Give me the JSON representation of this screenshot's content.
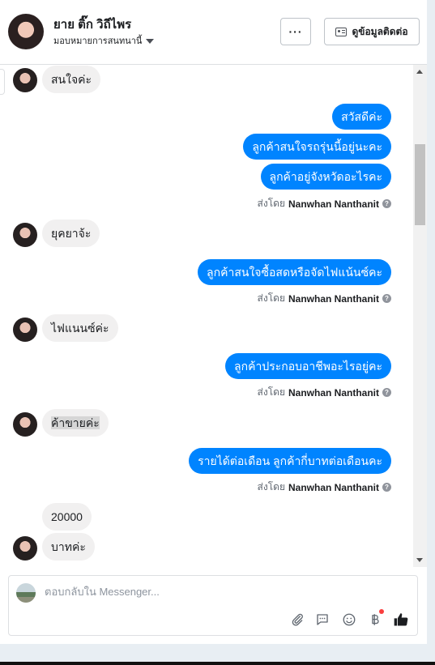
{
  "header": {
    "name": "ยาย ติ๊ก วิถีไพร",
    "assign_label": "มอบหมายการสนทนานี้",
    "more_label": "···",
    "contact_button": "ดูข้อมูลติดต่อ"
  },
  "messages": [
    {
      "dir": "in",
      "text": "สนใจค่ะ"
    },
    {
      "dir": "out",
      "text": "สวัสดีค่ะ"
    },
    {
      "dir": "out",
      "text": "ลูกค้าสนใจรถรุ่นนี้อยู่นะคะ"
    },
    {
      "dir": "out",
      "text": "ลูกค้าอยู่จังหวัดอะไรคะ"
    },
    {
      "dir": "in",
      "text": "ยุคยาจ้ะ"
    },
    {
      "dir": "out",
      "text": "ลูกค้าสนใจซื้อสดหรือจัดไฟแน้นซ์คะ"
    },
    {
      "dir": "in",
      "text": "ไฟแนนซ์ค่ะ"
    },
    {
      "dir": "out",
      "text": "ลูกค้าประกอบอาชีพอะไรอยู่คะ"
    },
    {
      "dir": "in",
      "text": "ค้าขายค่ะ"
    },
    {
      "dir": "out",
      "text": "รายได้ต่อเดือน ลูกค้ากี่บาทต่อเดือนคะ"
    },
    {
      "dir": "in",
      "text": "20000"
    },
    {
      "dir": "in",
      "text": "บาทค่ะ"
    }
  ],
  "sent_by": {
    "prefix": "ส่งโดย",
    "name": "Nanwhan Nanthanit",
    "info_icon": "?"
  },
  "composer": {
    "placeholder": "ตอบกลับใน Messenger..."
  },
  "icons": [
    "attachment-icon",
    "saved-reply-icon",
    "emoji-icon",
    "baht-payment-icon",
    "like-icon"
  ],
  "colors": {
    "outgoing_bubble": "#0084ff",
    "incoming_bubble": "#f1f0f0",
    "badge": "#fa3e3e"
  }
}
